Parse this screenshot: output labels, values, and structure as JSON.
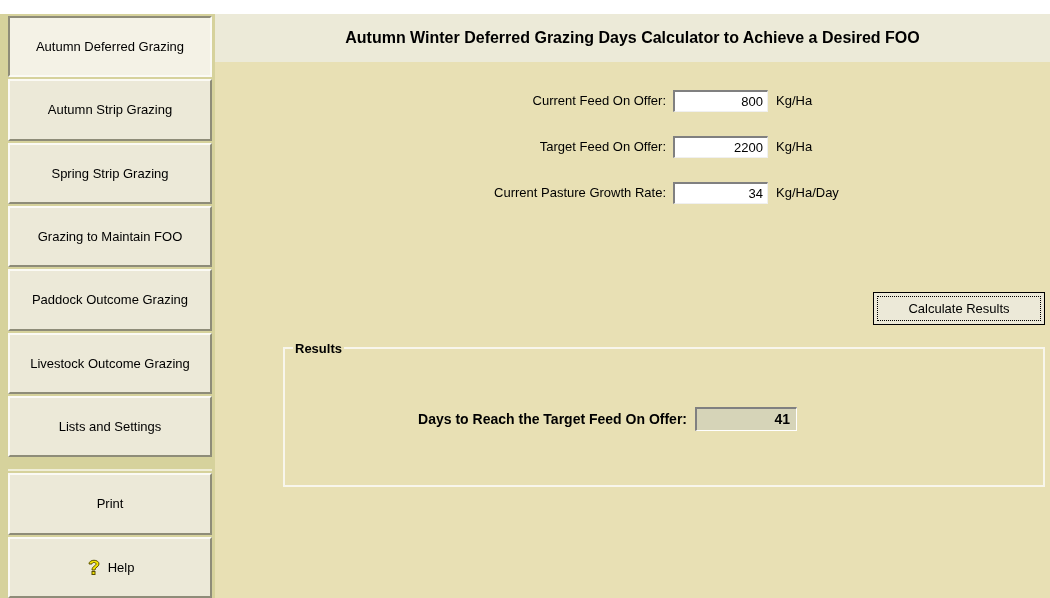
{
  "nav": [
    {
      "label": "Autumn Deferred Grazing",
      "selected": true
    },
    {
      "label": "Autumn Strip Grazing",
      "selected": false
    },
    {
      "label": "Spring Strip Grazing",
      "selected": false
    },
    {
      "label": "Grazing to Maintain FOO",
      "selected": false
    },
    {
      "label": "Paddock Outcome Grazing",
      "selected": false
    },
    {
      "label": "Livestock Outcome Grazing",
      "selected": false
    },
    {
      "label": "Lists and Settings",
      "selected": false
    }
  ],
  "actions": [
    {
      "label": "Print",
      "kind": "plain"
    },
    {
      "label": "Help",
      "kind": "help"
    }
  ],
  "title": "Autumn Winter Deferred Grazing Days Calculator to Achieve a Desired FOO",
  "inputs": [
    {
      "label": "Current Feed On Offer:",
      "value": "800",
      "unit": "Kg/Ha"
    },
    {
      "label": "Target Feed On Offer:",
      "value": "2200",
      "unit": "Kg/Ha"
    },
    {
      "label": "Current Pasture Growth Rate:",
      "value": "34",
      "unit": "Kg/Ha/Day"
    }
  ],
  "calculate_button": "Calculate Results",
  "results": {
    "title": "Results",
    "label": "Days to Reach the Target Feed On Offer:",
    "value": "41"
  }
}
